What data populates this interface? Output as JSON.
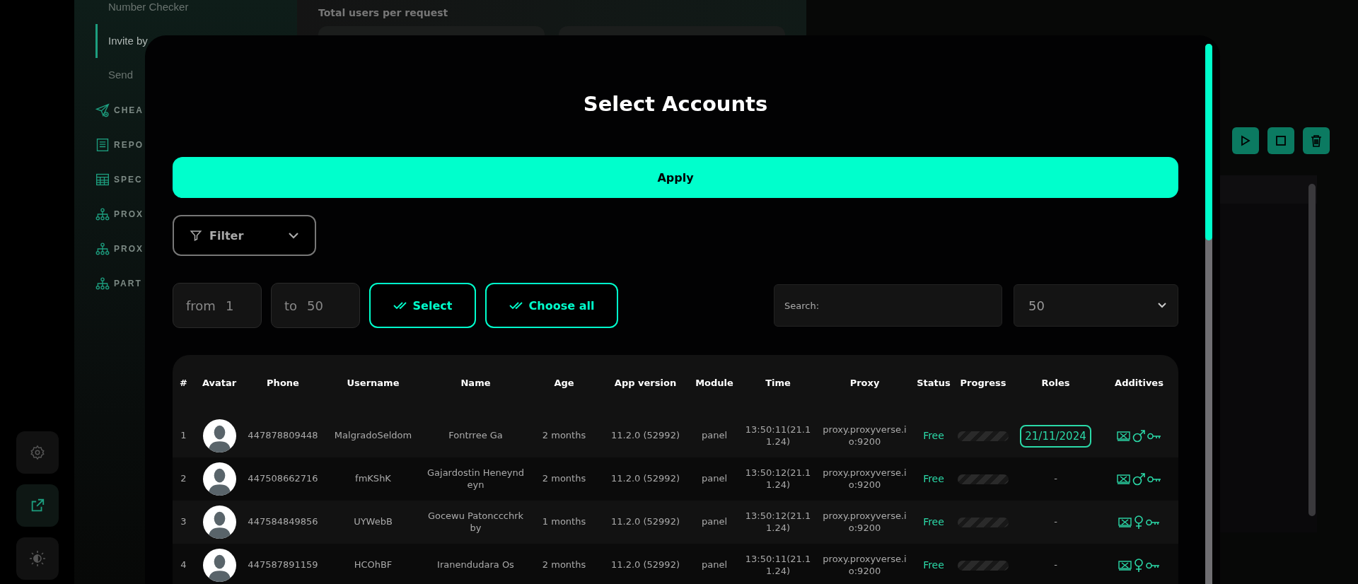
{
  "rail": [
    {
      "kind": "settings",
      "selected": false
    },
    {
      "kind": "external-link",
      "selected": true
    },
    {
      "kind": "theme",
      "selected": false
    }
  ],
  "sidebar": {
    "subitems": [
      {
        "label": "Number Checker",
        "selected": false
      },
      {
        "label": "Invite by",
        "selected": true
      },
      {
        "label": "Send",
        "selected": false
      }
    ],
    "sections": [
      {
        "kind": "send",
        "label": "CHEA"
      },
      {
        "kind": "report",
        "label": "REPO"
      },
      {
        "kind": "sheet",
        "label": "SPEC"
      },
      {
        "kind": "network",
        "label": "PROX"
      },
      {
        "kind": "network",
        "label": "PROX"
      },
      {
        "kind": "network",
        "label": "PART"
      }
    ]
  },
  "background": {
    "field_label": "Total users per request",
    "actions": [
      {
        "kind": "play"
      },
      {
        "kind": "stop"
      },
      {
        "kind": "delete"
      }
    ]
  },
  "modal": {
    "title": "Select Accounts",
    "apply": "Apply",
    "filter": "Filter",
    "range": {
      "from_label": "from",
      "from_value": "1",
      "to_label": "to",
      "to_value": "50"
    },
    "select": "Select",
    "choose_all": "Choose all",
    "search": {
      "placeholder": "Search:"
    },
    "page_size": "50",
    "table": {
      "columns": [
        "#",
        "Avatar",
        "Phone",
        "Username",
        "Name",
        "Age",
        "App version",
        "Module",
        "Time",
        "Proxy",
        "Status",
        "Progress",
        "Roles",
        "Additives"
      ],
      "rows": [
        {
          "number": "1",
          "phone": "447878809448",
          "username": "MalgradoSeldom",
          "name": "Fontrree Ga",
          "age": "2 months",
          "app_version": "11.2.0 (52992)",
          "module": "panel",
          "time": "13:50:11(21.11.24)",
          "proxy": "proxy.proxyverse.io:9200",
          "status": "Free",
          "level": 0,
          "roles": "21/11/2024",
          "roles_highlighted": true,
          "kind": "male"
        },
        {
          "number": "2",
          "phone": "447508662716",
          "username": "fmKShK",
          "name": "Gajardostin Heneyndeyn",
          "age": "2 months",
          "app_version": "11.2.0 (52992)",
          "module": "panel",
          "time": "13:50:12(21.11.24)",
          "proxy": "proxy.proxyverse.io:9200",
          "status": "Free",
          "level": 0,
          "roles": "-",
          "roles_highlighted": false,
          "kind": "male"
        },
        {
          "number": "3",
          "phone": "447584849856",
          "username": "UYWebB",
          "name": "Gocewu Patonccchrkby",
          "age": "1 months",
          "app_version": "11.2.0 (52992)",
          "module": "panel",
          "time": "13:50:12(21.11.24)",
          "proxy": "proxy.proxyverse.io:9200",
          "status": "Free",
          "level": 0,
          "roles": "-",
          "roles_highlighted": false,
          "kind": "female"
        },
        {
          "number": "4",
          "phone": "447587891159",
          "username": "HCOhBF",
          "name": "Iranendudara Os",
          "age": "2 months",
          "app_version": "11.2.0 (52992)",
          "module": "panel",
          "time": "13:50:11(21.11.24)",
          "proxy": "proxy.proxyverse.io:9200",
          "status": "Free",
          "level": 0,
          "roles": "-",
          "roles_highlighted": false,
          "kind": "female"
        }
      ]
    }
  }
}
